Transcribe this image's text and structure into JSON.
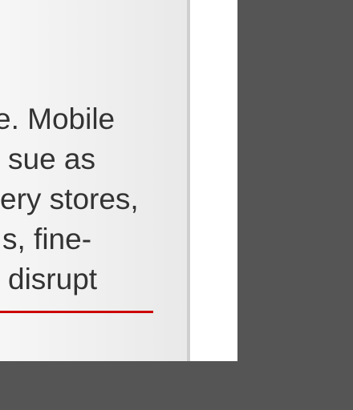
{
  "article": {
    "lines": [
      "e. Mobile",
      "sue as",
      "ery stores,",
      "s, fine-",
      "disrupt"
    ]
  },
  "colors": {
    "accent_rule": "#cc0000",
    "text": "#333333",
    "backdrop": "#555555"
  }
}
